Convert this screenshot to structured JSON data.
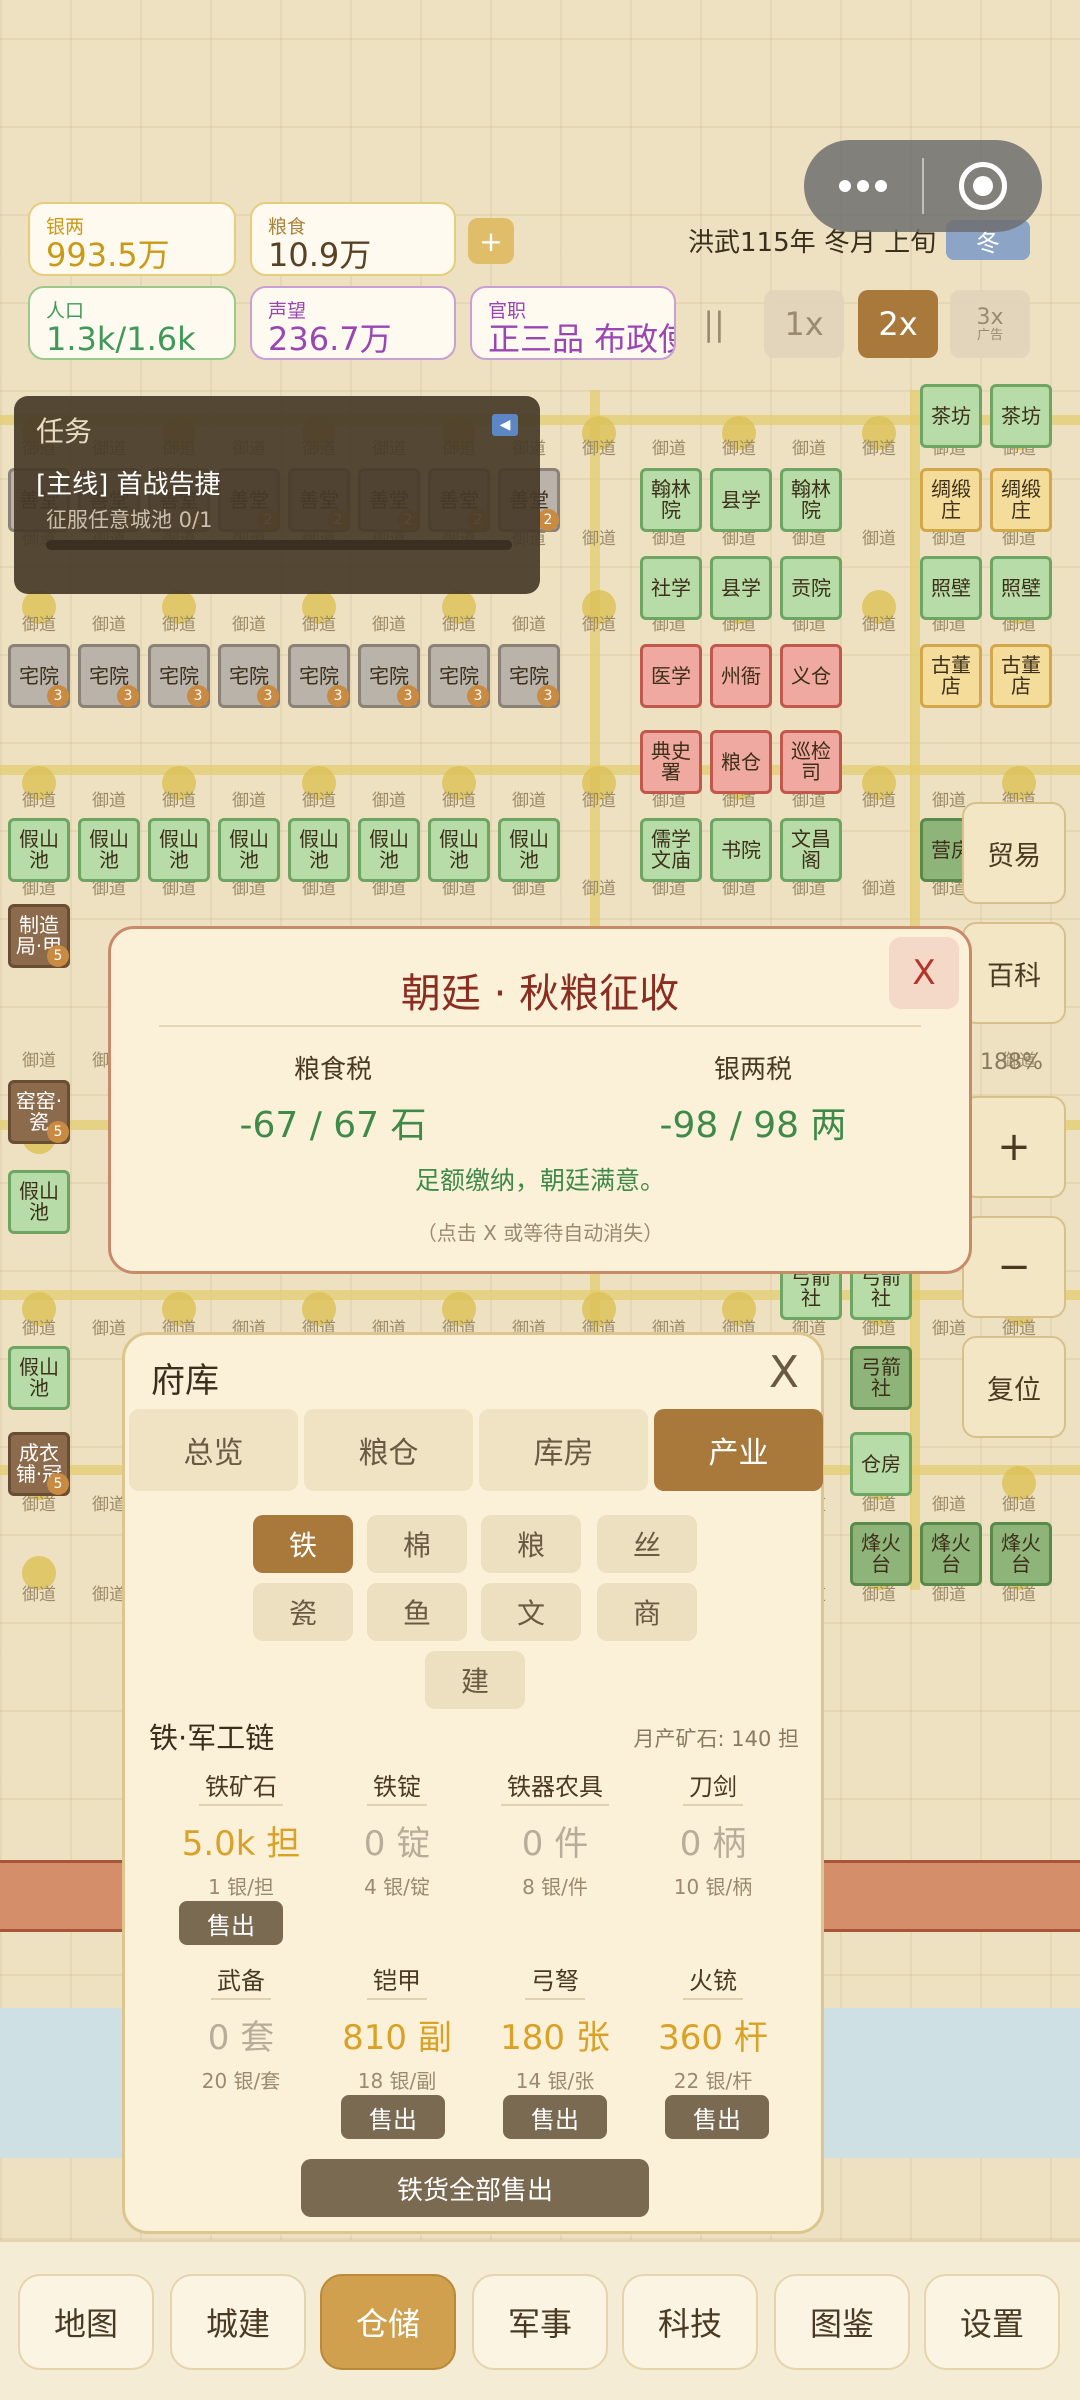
{
  "resources": {
    "silver": {
      "label": "银两",
      "value": "993.5万"
    },
    "grain": {
      "label": "粮食",
      "value": "10.9万"
    },
    "add": "+",
    "population": {
      "label": "人口",
      "value": "1.3k/1.6k"
    },
    "prestige": {
      "label": "声望",
      "value": "236.7万"
    },
    "rank": {
      "label": "官职",
      "value": "正三品 布政使"
    }
  },
  "date": "洪武115年 冬月 上旬",
  "season": "冬",
  "speed": {
    "pause": "||",
    "x1": "1x",
    "x2": "2x",
    "x3": "3x",
    "x3_note": "广告",
    "selected": "2x"
  },
  "task": {
    "title": "任务",
    "collapse": "◀",
    "main": "[主线] 首战告捷",
    "sub": "征服任意城池 0/1",
    "progress": 0
  },
  "map": {
    "road": "御道",
    "tiles_top": [
      "茶坊",
      "茶坊"
    ],
    "block1": [
      "翰林院",
      "县学",
      "翰林院",
      "绸缎庄",
      "绸缎庄"
    ],
    "block2": [
      "社学",
      "县学",
      "贡院",
      "照壁",
      "照壁"
    ],
    "block3": [
      "医学",
      "州衙",
      "义仓",
      "古董店",
      "古董店"
    ],
    "block4": [
      "典史署",
      "粮仓",
      "巡检司"
    ],
    "block5": [
      "儒学文庙",
      "书院",
      "文昌阁",
      "营房"
    ],
    "shantang": "善堂",
    "zhaiyuan": "宅院",
    "jiashanchi": "假山池",
    "zaoju": "制造局·甲",
    "yaoku": "窑窑·瓷",
    "chengyi": "成衣铺·冠",
    "gongjian": "弓箭社",
    "cangfang": "仓房",
    "fenghuo": "烽火台",
    "level2": "2",
    "level3": "3",
    "level5": "5"
  },
  "side": {
    "trade": "贸易",
    "wiki": "百科",
    "zoom": "188%",
    "zoom_in": "+",
    "zoom_out": "−",
    "reset": "复位"
  },
  "tax_popup": {
    "title": "朝廷 · 秋粮征收",
    "close": "X",
    "grain_tax_label": "粮食税",
    "grain_tax_value": "-67 / 67 石",
    "silver_tax_label": "银两税",
    "silver_tax_value": "-98 / 98 两",
    "message": "足额缴纳，朝廷满意。",
    "hint": "（点击 X 或等待自动消失）"
  },
  "warehouse": {
    "title": "府库",
    "close": "X",
    "tabs": [
      "总览",
      "粮仓",
      "库房",
      "产业"
    ],
    "active_tab": "产业",
    "chips": [
      "铁",
      "棉",
      "粮",
      "丝",
      "瓷",
      "鱼",
      "文",
      "商",
      "建"
    ],
    "active_chip": "铁",
    "chain_title": "铁·军工链",
    "monthly": "月产矿石: 140 担",
    "items": [
      {
        "name": "铁矿石",
        "qty": "5.0k 担",
        "price": "1 银/担"
      },
      {
        "name": "铁锭",
        "qty": "0 锭",
        "price": "4 银/锭"
      },
      {
        "name": "铁器农具",
        "qty": "0 件",
        "price": "8 银/件"
      },
      {
        "name": "刀剑",
        "qty": "0 柄",
        "price": "10 银/柄"
      },
      {
        "name": "武备",
        "qty": "0 套",
        "price": "20 银/套"
      },
      {
        "name": "铠甲",
        "qty": "810 副",
        "price": "18 银/副"
      },
      {
        "name": "弓弩",
        "qty": "180 张",
        "price": "14 银/张"
      },
      {
        "name": "火铳",
        "qty": "360 杆",
        "price": "22 银/杆"
      }
    ],
    "sell": "售出",
    "sell_all": "铁货全部售出"
  },
  "nav": [
    "地图",
    "城建",
    "仓储",
    "军事",
    "科技",
    "图鉴",
    "设置"
  ],
  "nav_active": "仓储",
  "colors": {
    "accent": "#a9793c",
    "gold": "#d9a126",
    "green_text": "#3f8a4a",
    "red_title": "#8b2e22"
  }
}
